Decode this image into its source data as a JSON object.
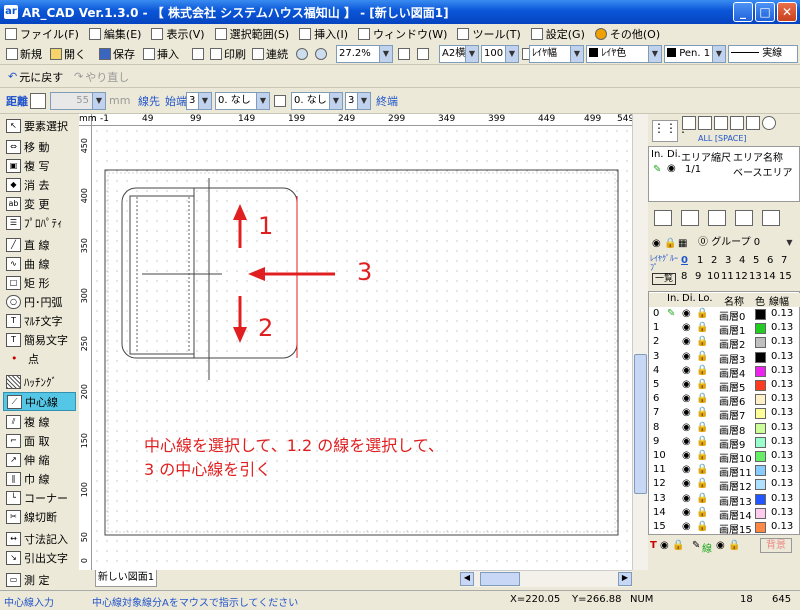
{
  "window": {
    "title": "AR_CAD Ver.1.3.0  - 【 株式会社 システムハウス福知山 】 - [新しい図面1]",
    "app_icon": "ar"
  },
  "menu": [
    "ファイル(F)",
    "編集(E)",
    "表示(V)",
    "選択範囲(S)",
    "挿入(I)",
    "ウィンドウ(W)",
    "ツール(T)",
    "設定(G)",
    "その他(O)"
  ],
  "toolbar1": {
    "new": "新規",
    "open": "開く",
    "save": "保存",
    "insert": "挿入",
    "print": "印刷",
    "continuous": "連続",
    "zoom": "27.2%",
    "paper": "A2横",
    "scale": "100",
    "layer_width": "ﾚｲﾔ幅",
    "layer_color": "ﾚｲﾔ色",
    "pen": "Pen. 1",
    "line_type": "実線"
  },
  "toolbar2": {
    "undo": "元に戻す",
    "redo": "やり直し"
  },
  "toolbar3": {
    "distance": "距離",
    "distance_value": "55",
    "unit": "mm",
    "line_end_label": "線先",
    "start_label": "始端",
    "start_value": "3",
    "none1": "0. なし",
    "none2": "0. なし",
    "end_value": "3",
    "end_label": "終端"
  },
  "tools": [
    "要素選択",
    "移 動",
    "複 写",
    "消 去",
    "変 更",
    "ﾌﾟﾛﾊﾟﾃｨ",
    "直 線",
    "曲 線",
    "矩 形",
    "円･円弧",
    "ﾏﾙﾁ文字",
    "簡易文字",
    "点",
    "ﾊｯﾁﾝｸﾞ",
    "中心線",
    "複 線",
    "面 取",
    "伸 縮",
    "巾 線",
    "コーナー",
    "線切断",
    "寸法記入",
    "引出文字",
    "測 定"
  ],
  "active_tool": "中心線",
  "ruler": {
    "top": [
      "mm",
      "-1",
      "49",
      "99",
      "149",
      "199",
      "249",
      "299",
      "349",
      "399",
      "449",
      "499",
      "549",
      "59"
    ],
    "left": [
      "450",
      "400",
      "350",
      "300",
      "250",
      "200",
      "150",
      "100",
      "50",
      "0"
    ]
  },
  "annotations": {
    "label1": "1",
    "label2": "2",
    "label3": "3",
    "instruction_line1": "中心線を選択して、1.2 の線を選択して、",
    "instruction_line2": "3 の中心線を引く",
    "color": "#e02020"
  },
  "tab": "新しい図面1",
  "right_panel": {
    "snap_label": "ALL [SPACE]",
    "area_headers": [
      "In.",
      "Di.",
      "エリア縮尺",
      "エリア名称"
    ],
    "area_row": {
      "scale": "1/1",
      "name": "ベースエリア"
    },
    "group": "グループ 0",
    "layer_group_label": "ﾚｲﾔｸﾞﾙｰﾌﾟ",
    "list_all": "一覧",
    "group_numbers": [
      "0",
      "1",
      "2",
      "3",
      "4",
      "5",
      "6",
      "7",
      "8",
      "9",
      "10",
      "11",
      "12",
      "13",
      "14",
      "15"
    ],
    "layer_headers": [
      "In.",
      "Di.",
      "Lo.",
      "名称",
      "色",
      "線幅"
    ],
    "layers": [
      {
        "num": "0",
        "name": "画層0",
        "color": "#000000",
        "width": "0.13"
      },
      {
        "num": "1",
        "name": "画層1",
        "color": "#22cc22",
        "width": "0.13"
      },
      {
        "num": "2",
        "name": "画層2",
        "color": "#bfbfbf",
        "width": "0.13"
      },
      {
        "num": "3",
        "name": "画層3",
        "color": "#000000",
        "width": "0.13"
      },
      {
        "num": "4",
        "name": "画層4",
        "color": "#ee22ee",
        "width": "0.13"
      },
      {
        "num": "5",
        "name": "画層5",
        "color": "#ff3b1f",
        "width": "0.13"
      },
      {
        "num": "6",
        "name": "画層6",
        "color": "#fff0c8",
        "width": "0.13"
      },
      {
        "num": "7",
        "name": "画層7",
        "color": "#ffff99",
        "width": "0.13"
      },
      {
        "num": "8",
        "name": "画層8",
        "color": "#ccff99",
        "width": "0.13"
      },
      {
        "num": "9",
        "name": "画層9",
        "color": "#99ffcc",
        "width": "0.13"
      },
      {
        "num": "10",
        "name": "画層10",
        "color": "#66ee66",
        "width": "0.13"
      },
      {
        "num": "11",
        "name": "画層11",
        "color": "#88ccff",
        "width": "0.13"
      },
      {
        "num": "12",
        "name": "画層12",
        "color": "#b0e0ff",
        "width": "0.13"
      },
      {
        "num": "13",
        "name": "画層13",
        "color": "#2255ff",
        "width": "0.13"
      },
      {
        "num": "14",
        "name": "画層14",
        "color": "#ffccee",
        "width": "0.13"
      },
      {
        "num": "15",
        "name": "画層15",
        "color": "#ff8844",
        "width": "0.13"
      }
    ],
    "footer": {
      "t_label": "T",
      "line_label": "線",
      "background": "背景"
    }
  },
  "status": {
    "mode": "中心線入力",
    "hint": "中心線対象線分Aをマウスで指示してください",
    "x": "X=220.05",
    "y": "Y=266.88",
    "num": "NUM",
    "count": "18",
    "value": "645"
  }
}
